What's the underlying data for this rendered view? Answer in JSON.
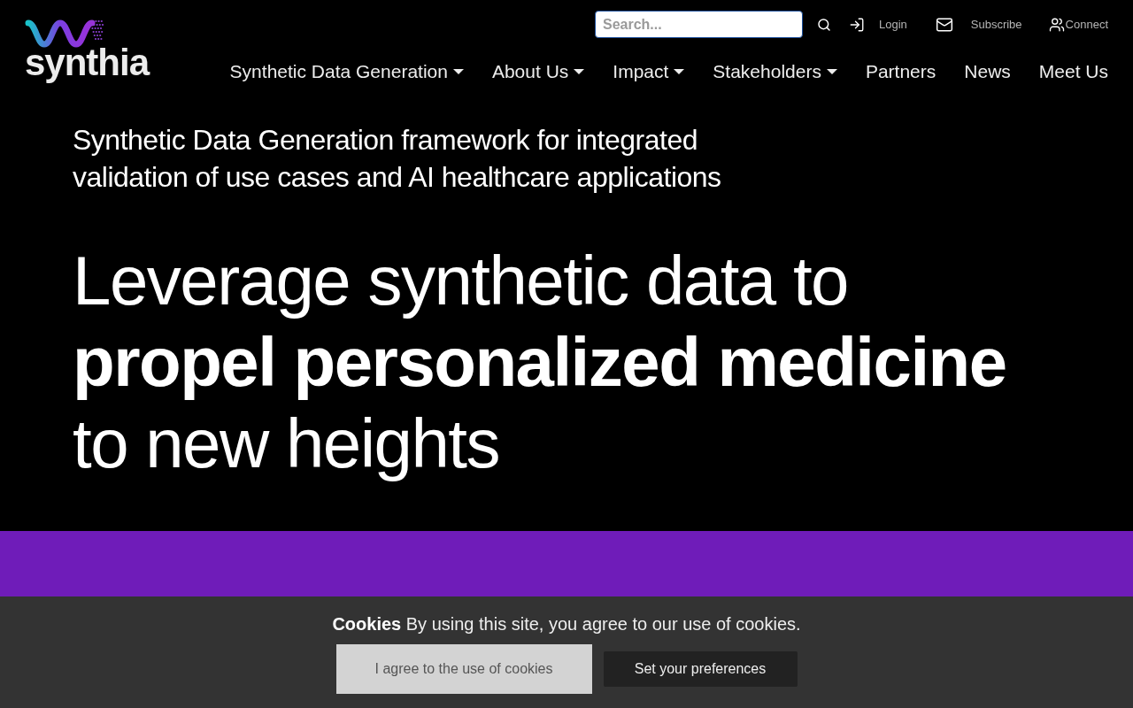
{
  "logo": {
    "text": "synthia"
  },
  "search": {
    "placeholder": "Search..."
  },
  "top_links": [
    {
      "label": "Login",
      "kind": "login"
    },
    {
      "label": "Subscribe",
      "kind": "mail"
    },
    {
      "label": "Connect",
      "kind": "users"
    }
  ],
  "nav": [
    {
      "label": "Synthetic Data Generation",
      "dropdown": true
    },
    {
      "label": "About Us",
      "dropdown": true
    },
    {
      "label": "Impact",
      "dropdown": true
    },
    {
      "label": "Stakeholders",
      "dropdown": true
    },
    {
      "label": "Partners",
      "dropdown": false
    },
    {
      "label": "News",
      "dropdown": false
    },
    {
      "label": "Meet Us",
      "dropdown": false
    }
  ],
  "hero": {
    "subtitle": "Synthetic Data Generation framework for integrated validation of use cases and AI healthcare applications",
    "headline": "Leverage synthetic data to **propel personalized medicine** to new heights"
  },
  "cookie_banner": {
    "text": "**Cookies** By using this site, you agree to our use of cookies.",
    "buttons": [
      {
        "label": "I agree to the use of cookies",
        "kind": "primary"
      },
      {
        "label": "Set your preferences",
        "kind": "secondary"
      }
    ]
  }
}
